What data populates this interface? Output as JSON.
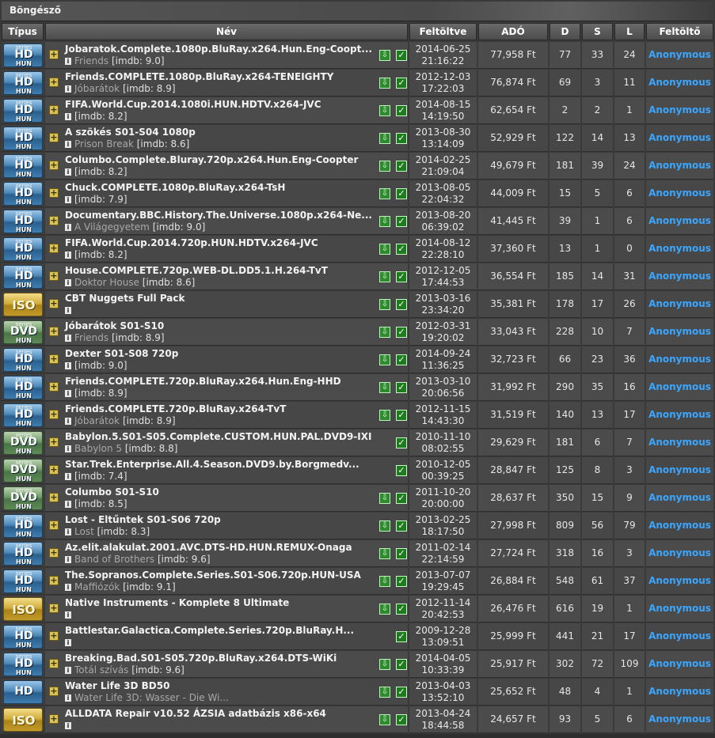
{
  "window": {
    "title": "Böngésző"
  },
  "columns": {
    "type": "Típus",
    "name": "Név",
    "uploaded": "Feltöltve",
    "size": "ADÓ",
    "d": "D",
    "s": "S",
    "l": "L",
    "uploader": "Feltöltő"
  },
  "rows": [
    {
      "badge": "hd",
      "name": "Jobaratok.Complete.1080p.BluRay.x264.Hun.Eng-Coopt...",
      "alt": "Friends",
      "imdb": "[imdb: 9.0]",
      "dl": true,
      "date": "2014-06-25",
      "time": "21:16:22",
      "size": "77,958 Ft",
      "d": "77",
      "s": "33",
      "l": "24",
      "uploader": "Anonymous"
    },
    {
      "badge": "hd",
      "name": "Friends.COMPLETE.1080p.BluRay.x264-TENEIGHTY",
      "alt": "Jóbarátok",
      "imdb": "[imdb: 8.9]",
      "dl": true,
      "date": "2012-12-03",
      "time": "17:22:03",
      "size": "76,874 Ft",
      "d": "69",
      "s": "3",
      "l": "11",
      "uploader": "Anonymous"
    },
    {
      "badge": "hd",
      "name": "FIFA.World.Cup.2014.1080i.HUN.HDTV.x264-JVC",
      "alt": "",
      "imdb": "[imdb: 8.2]",
      "dl": true,
      "date": "2014-08-15",
      "time": "14:19:50",
      "size": "62,654 Ft",
      "d": "2",
      "s": "2",
      "l": "1",
      "uploader": "Anonymous"
    },
    {
      "badge": "hd",
      "name": "A szökés S01-S04 1080p",
      "alt": "Prison Break",
      "imdb": "[imdb: 8.6]",
      "dl": true,
      "date": "2013-08-30",
      "time": "13:14:09",
      "size": "52,929 Ft",
      "d": "122",
      "s": "14",
      "l": "13",
      "uploader": "Anonymous"
    },
    {
      "badge": "hd",
      "name": "Columbo.Complete.Bluray.720p.x264.Hun.Eng-Coopter",
      "alt": "",
      "imdb": "[imdb: 8.2]",
      "dl": true,
      "date": "2014-02-25",
      "time": "21:09:04",
      "size": "49,679 Ft",
      "d": "181",
      "s": "39",
      "l": "24",
      "uploader": "Anonymous"
    },
    {
      "badge": "hd",
      "name": "Chuck.COMPLETE.1080p.BluRay.x264-TsH",
      "alt": "",
      "imdb": "[imdb: 7.9]",
      "dl": true,
      "date": "2013-08-05",
      "time": "22:04:32",
      "size": "44,009 Ft",
      "d": "15",
      "s": "5",
      "l": "6",
      "uploader": "Anonymous"
    },
    {
      "badge": "hd",
      "name": "Documentary.BBC.History.The.Universe.1080p.x264-Ne...",
      "alt": "A Világegyetem",
      "imdb": "[imdb: 9.0]",
      "dl": true,
      "date": "2013-08-20",
      "time": "06:39:02",
      "size": "41,445 Ft",
      "d": "39",
      "s": "1",
      "l": "6",
      "uploader": "Anonymous"
    },
    {
      "badge": "hd",
      "name": "FIFA.World.Cup.2014.720p.HUN.HDTV.x264-JVC",
      "alt": "",
      "imdb": "[imdb: 8.2]",
      "dl": true,
      "date": "2014-08-12",
      "time": "22:28:10",
      "size": "37,360 Ft",
      "d": "13",
      "s": "1",
      "l": "0",
      "uploader": "Anonymous"
    },
    {
      "badge": "hd",
      "name": "House.COMPLETE.720p.WEB-DL.DD5.1.H.264-TvT",
      "alt": "Doktor House",
      "imdb": "[imdb: 8.6]",
      "dl": true,
      "date": "2012-12-05",
      "time": "17:44:53",
      "size": "36,554 Ft",
      "d": "185",
      "s": "14",
      "l": "31",
      "uploader": "Anonymous"
    },
    {
      "badge": "iso",
      "name": "CBT Nuggets Full Pack",
      "alt": "",
      "imdb": "",
      "dl": true,
      "date": "2013-03-16",
      "time": "23:34:20",
      "size": "35,381 Ft",
      "d": "178",
      "s": "17",
      "l": "26",
      "uploader": "Anonymous"
    },
    {
      "badge": "dvd",
      "name": "Jóbarátok S01-S10",
      "alt": "Friends",
      "imdb": "[imdb: 8.9]",
      "dl": true,
      "date": "2012-03-31",
      "time": "19:20:02",
      "size": "33,043 Ft",
      "d": "228",
      "s": "10",
      "l": "7",
      "uploader": "Anonymous"
    },
    {
      "badge": "hd",
      "name": "Dexter S01-S08 720p",
      "alt": "",
      "imdb": "[imdb: 9.0]",
      "dl": true,
      "date": "2014-09-24",
      "time": "11:36:25",
      "size": "32,723 Ft",
      "d": "66",
      "s": "23",
      "l": "36",
      "uploader": "Anonymous"
    },
    {
      "badge": "hd",
      "name": "Friends.COMPLETE.720p.BluRay.x264.Hun.Eng-HHD",
      "alt": "",
      "imdb": "[imdb: 8.9]",
      "dl": true,
      "date": "2013-03-10",
      "time": "20:06:56",
      "size": "31,992 Ft",
      "d": "290",
      "s": "35",
      "l": "16",
      "uploader": "Anonymous"
    },
    {
      "badge": "hd",
      "name": "Friends.COMPLETE.720p.BluRay.x264-TvT",
      "alt": "Jóbarátok",
      "imdb": "[imdb: 8.9]",
      "dl": true,
      "date": "2012-11-15",
      "time": "14:43:30",
      "size": "31,519 Ft",
      "d": "140",
      "s": "13",
      "l": "17",
      "uploader": "Anonymous"
    },
    {
      "badge": "dvd",
      "name": "Babylon.5.S01-S05.Complete.CUSTOM.HUN.PAL.DVD9-IXI",
      "alt": "Babylon 5",
      "imdb": "[imdb: 8.8]",
      "dl": false,
      "date": "2010-11-10",
      "time": "08:02:55",
      "size": "29,629 Ft",
      "d": "181",
      "s": "6",
      "l": "7",
      "uploader": "Anonymous"
    },
    {
      "badge": "dvd",
      "name": "Star.Trek.Enterprise.All.4.Season.DVD9.by.Borgmedv...",
      "alt": "",
      "imdb": "[imdb: 7.4]",
      "dl": false,
      "date": "2010-12-05",
      "time": "00:39:25",
      "size": "28,847 Ft",
      "d": "125",
      "s": "8",
      "l": "3",
      "uploader": "Anonymous"
    },
    {
      "badge": "dvd",
      "name": "Columbo S01-S10",
      "alt": "",
      "imdb": "[imdb: 8.5]",
      "dl": true,
      "date": "2011-10-20",
      "time": "20:00:00",
      "size": "28,637 Ft",
      "d": "350",
      "s": "15",
      "l": "9",
      "uploader": "Anonymous"
    },
    {
      "badge": "hd",
      "name": "Lost - Eltűntek S01-S06 720p",
      "alt": "Lost",
      "imdb": "[imdb: 8.3]",
      "dl": true,
      "date": "2013-02-25",
      "time": "18:17:50",
      "size": "27,998 Ft",
      "d": "809",
      "s": "56",
      "l": "79",
      "uploader": "Anonymous"
    },
    {
      "badge": "hd",
      "name": "Az.elit.alakulat.2001.AVC.DTS-HD.HUN.REMUX-Onaga",
      "alt": "Band of Brothers",
      "imdb": "[imdb: 9.6]",
      "dl": true,
      "date": "2011-02-14",
      "time": "22:14:59",
      "size": "27,724 Ft",
      "d": "318",
      "s": "16",
      "l": "3",
      "uploader": "Anonymous"
    },
    {
      "badge": "hd",
      "name": "The.Sopranos.Complete.Series.S01-S06.720p.HUN-USA",
      "alt": "Maffiózók",
      "imdb": "[imdb: 9.1]",
      "dl": true,
      "date": "2013-07-07",
      "time": "19:29:45",
      "size": "26,884 Ft",
      "d": "548",
      "s": "61",
      "l": "37",
      "uploader": "Anonymous"
    },
    {
      "badge": "iso",
      "name": "Native Instruments - Komplete 8 Ultimate",
      "alt": "",
      "imdb": "",
      "dl": true,
      "date": "2012-11-14",
      "time": "20:42:53",
      "size": "26,476 Ft",
      "d": "616",
      "s": "19",
      "l": "1",
      "uploader": "Anonymous"
    },
    {
      "badge": "hd",
      "name": "Battlestar.Galactica.Complete.Series.720p.BluRay.H...",
      "alt": "",
      "imdb": "",
      "dl": false,
      "date": "2009-12-28",
      "time": "13:09:51",
      "size": "25,999 Ft",
      "d": "441",
      "s": "21",
      "l": "17",
      "uploader": "Anonymous"
    },
    {
      "badge": "hd",
      "name": "Breaking.Bad.S01-S05.720p.BluRay.x264.DTS-WiKi",
      "alt": "Totál szívás",
      "imdb": "[imdb: 9.6]",
      "dl": true,
      "date": "2014-04-05",
      "time": "10:33:39",
      "size": "25,917 Ft",
      "d": "302",
      "s": "72",
      "l": "109",
      "uploader": "Anonymous"
    },
    {
      "badge": "hd3d",
      "name": "Water Life 3D BD50",
      "alt": "Water Life 3D: Wasser - Die Wi...",
      "imdb": "",
      "dl": true,
      "date": "2013-04-03",
      "time": "13:52:10",
      "size": "25,652 Ft",
      "d": "48",
      "s": "4",
      "l": "1",
      "uploader": "Anonymous"
    },
    {
      "badge": "iso",
      "name": "ALLDATA Repair v10.52 ÁZSIA adatbázis x86-x64",
      "alt": "",
      "imdb": "",
      "dl": true,
      "date": "2013-04-24",
      "time": "18:44:58",
      "size": "24,657 Ft",
      "d": "93",
      "s": "5",
      "l": "6",
      "uploader": "Anonymous"
    }
  ],
  "badges": {
    "hd": {
      "top": "series",
      "mid": "HD",
      "bot": "HUN"
    },
    "hd3d": {
      "top": "",
      "mid": "HD",
      "bot": ""
    },
    "dvd": {
      "top": "series",
      "mid": "DVD",
      "bot": "HUN"
    },
    "iso": {
      "top": "",
      "mid": "ISO",
      "bot": ""
    }
  },
  "colors": {
    "uploader_link": "#3aa6ff",
    "row_bg": "#4b4b4b",
    "ok_icon": "#1e7c1e"
  }
}
